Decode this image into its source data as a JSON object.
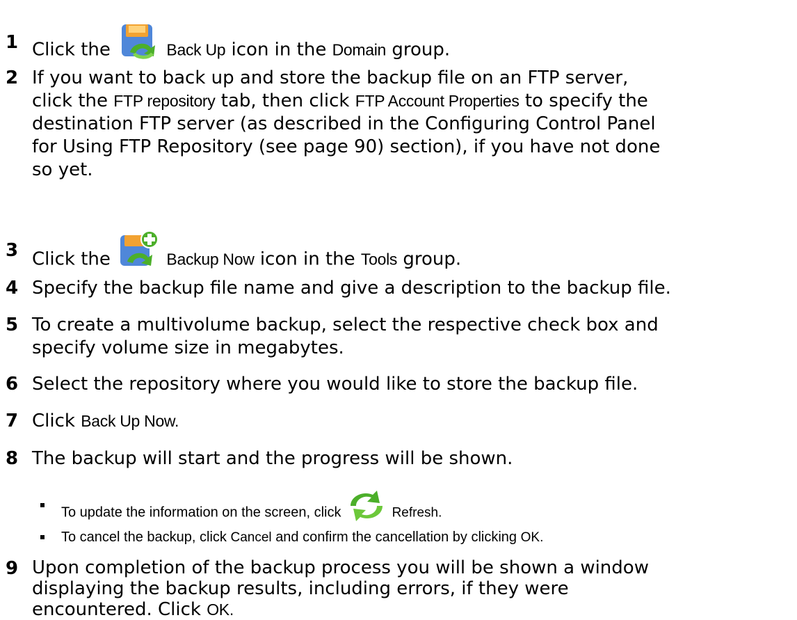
{
  "steps": [
    {
      "num": "1",
      "a": "Click the",
      "b": "Back Up",
      "c": "icon in the",
      "d": "Domain",
      "e": "group."
    },
    {
      "num": "2",
      "l1": "If you want to back up and store the backup file on an FTP server,",
      "l2a": "click the",
      "l2b": "FTP repository",
      "l2c": "tab, then click",
      "l2d": "FTP Account Properties",
      "l2e": "to specify the",
      "l3": "destination FTP server (as described in the Configuring Control Panel",
      "l4": "for Using FTP Repository (see page 90) section), if you have not done",
      "l5": "so yet."
    },
    {
      "num": "3",
      "a": "Click the",
      "b": "Backup Now",
      "c": "icon in the",
      "d": "Tools",
      "e": "group."
    },
    {
      "num": "4",
      "text": "Specify the backup file name and give a description to the backup file."
    },
    {
      "num": "5",
      "l1": "To create a multivolume backup, select the respective check box and",
      "l2": "specify volume size in megabytes."
    },
    {
      "num": "6",
      "text": "Select the repository where you would like to store the backup file."
    },
    {
      "num": "7",
      "a": "Click",
      "b": "Back Up Now",
      "c": "."
    },
    {
      "num": "8",
      "text": "The backup will start and the progress will be shown."
    },
    {
      "num": "9",
      "l1": "Upon completion of the backup process you will be shown a window",
      "l2": "displaying the backup results, including errors, if they were",
      "l3a": "encountered. Click",
      "l3b": "OK",
      "l3c": "."
    }
  ],
  "bullets": [
    {
      "a": "To update the information on the screen, click",
      "b": "Refresh",
      "c": "."
    },
    {
      "a": "To cancel the backup, click",
      "b": "Cancel",
      "c": "and confirm the cancellation by clicking",
      "d": "OK",
      "e": "."
    }
  ],
  "icons": {
    "back_up": "backup-disk-icon",
    "backup_now": "backup-now-icon",
    "refresh": "refresh-icon"
  },
  "colors": {
    "disk_orange": "#f2a232",
    "disk_blue": "#4f87d9",
    "arrow_green": "#4caf2a"
  }
}
